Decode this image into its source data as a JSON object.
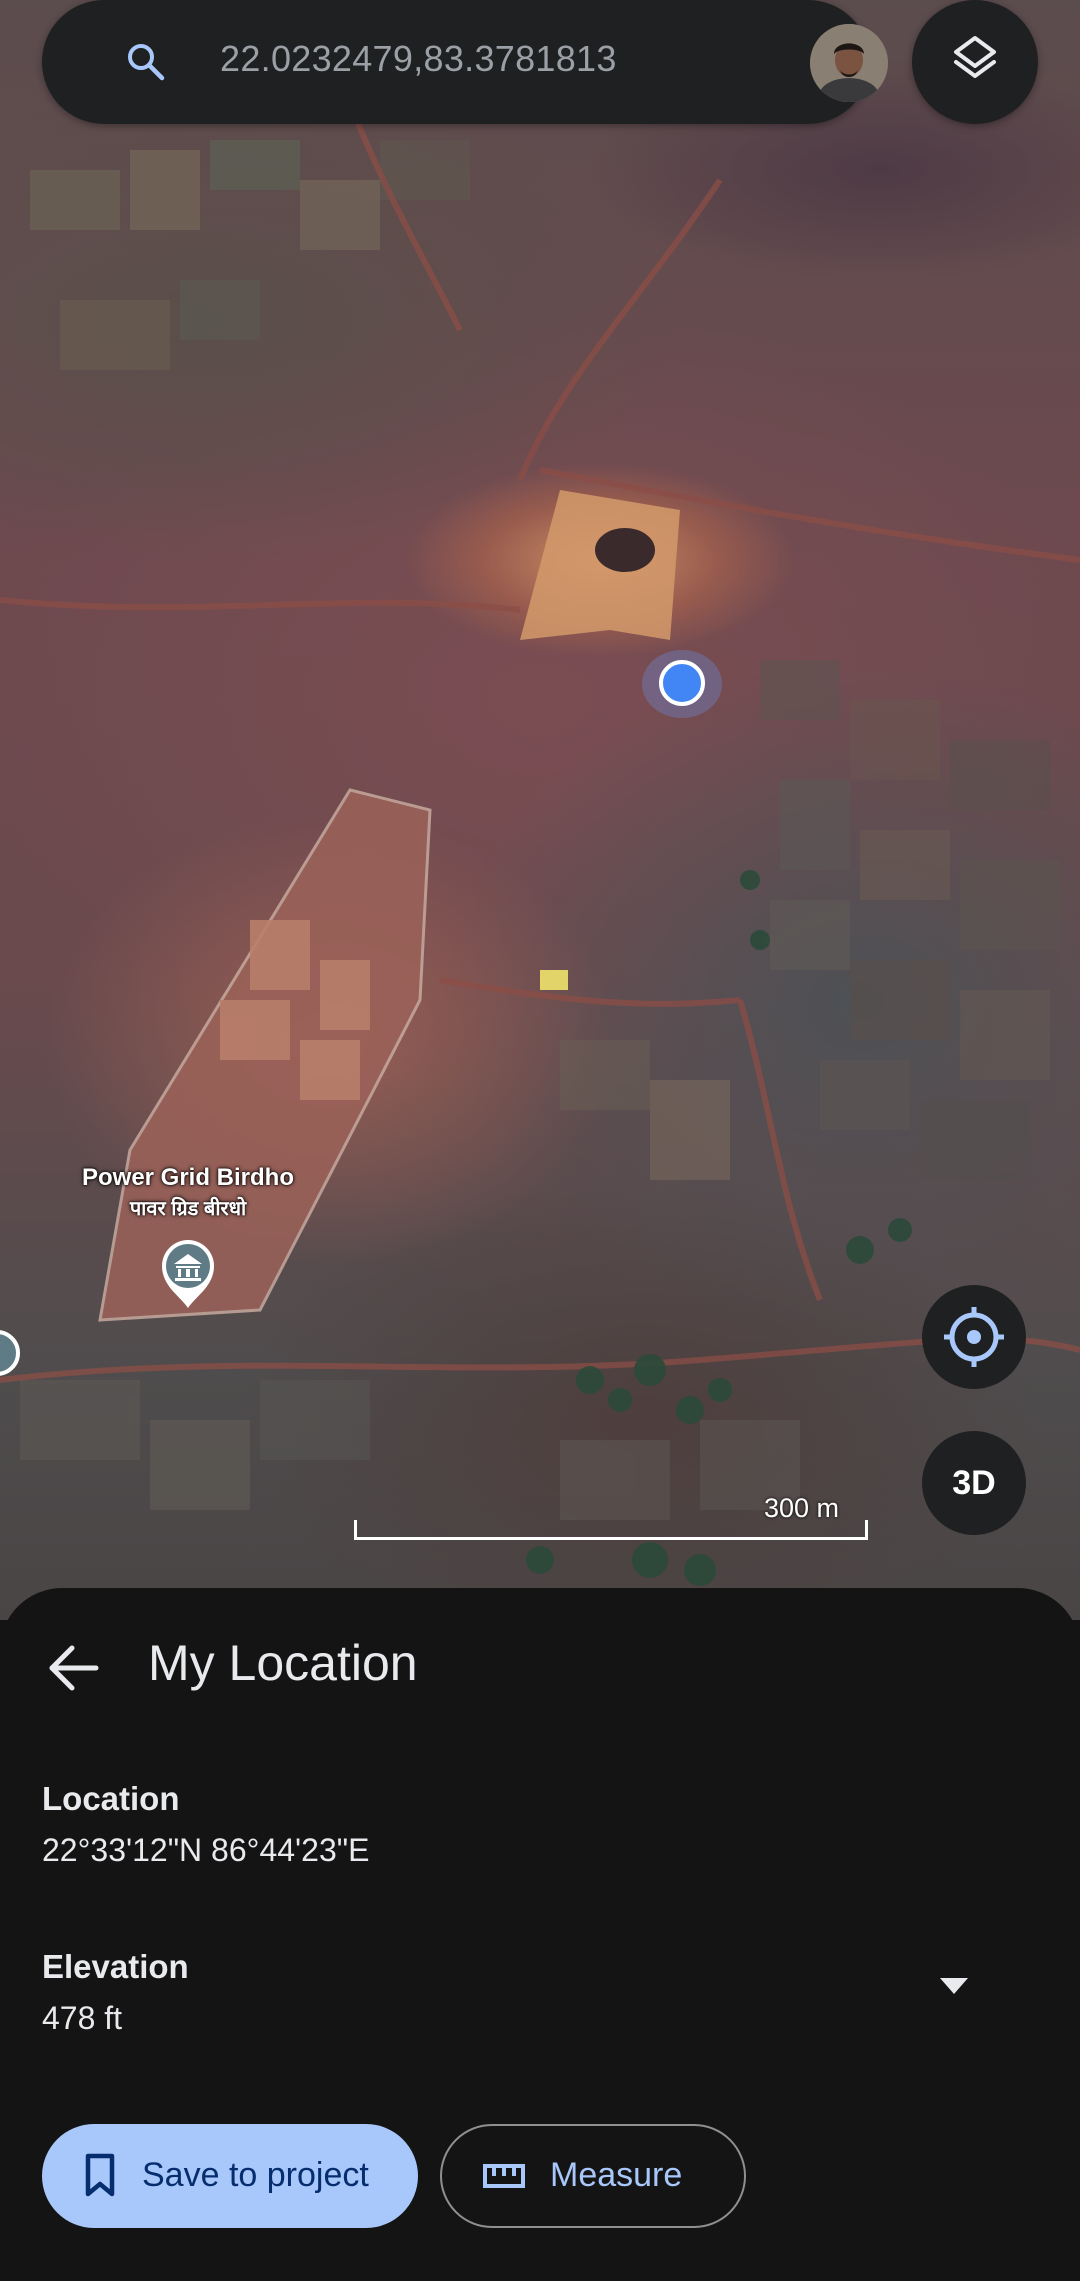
{
  "search": {
    "query": "22.0232479,83.3781813"
  },
  "map": {
    "poi": {
      "title": "Power Grid Birdho",
      "subtitle": "पावर ग्रिड बीरधो"
    },
    "scale_label": "300 m",
    "three_d_label": "3D"
  },
  "sheet": {
    "title": "My Location",
    "location_label": "Location",
    "location_value": "22°33'12\"N 86°44'23\"E",
    "elevation_label": "Elevation",
    "elevation_value": "478 ft",
    "save_label": "Save to project",
    "measure_label": "Measure"
  },
  "colors": {
    "accent": "#a8c7fa",
    "location_dot": "#4285f4",
    "sheet_background": "#141414"
  },
  "icons": [
    "search-icon",
    "layers-icon",
    "my-location-icon",
    "back-arrow-icon",
    "chevron-down-icon",
    "bookmark-icon",
    "ruler-icon",
    "building-icon"
  ]
}
